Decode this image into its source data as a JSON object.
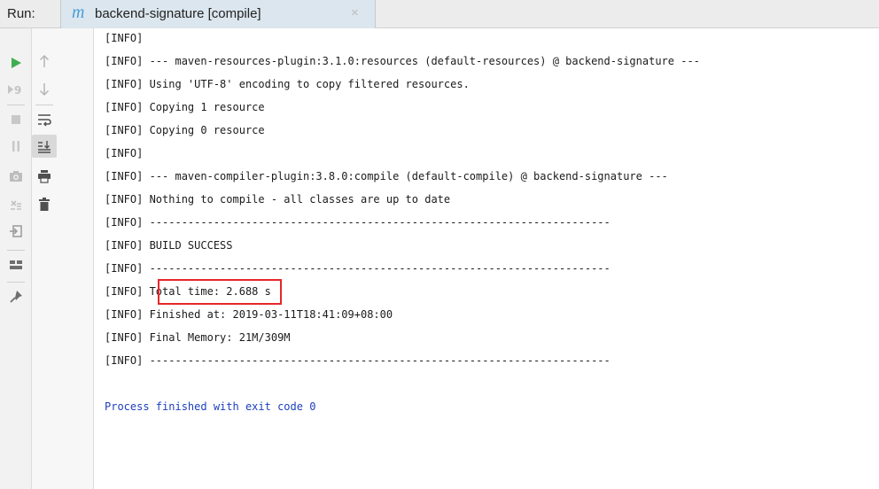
{
  "panel": {
    "run_label": "Run:",
    "tab": {
      "icon": "maven-m-icon",
      "icon_glyph": "m",
      "label": "backend-signature [compile]",
      "close_glyph": "×"
    }
  },
  "toolbar_left": [
    {
      "name": "run-icon"
    },
    {
      "name": "rerun-failed-icon"
    },
    {
      "name": "stop-icon"
    },
    {
      "name": "pause-icon"
    },
    {
      "name": "screenshot-icon"
    },
    {
      "name": "exclude-icon"
    },
    {
      "name": "import-icon"
    },
    {
      "name": "layout-icon"
    },
    {
      "name": "pin-icon"
    }
  ],
  "toolbar_right": [
    {
      "name": "up-arrow-icon"
    },
    {
      "name": "down-arrow-icon"
    },
    {
      "name": "soft-wrap-icon"
    },
    {
      "name": "scroll-to-end-icon"
    },
    {
      "name": "print-icon"
    },
    {
      "name": "trash-icon"
    }
  ],
  "console": {
    "lines": [
      "[INFO]",
      "[INFO] --- maven-resources-plugin:3.1.0:resources (default-resources) @ backend-signature ---",
      "[INFO] Using 'UTF-8' encoding to copy filtered resources.",
      "[INFO] Copying 1 resource",
      "[INFO] Copying 0 resource",
      "[INFO]",
      "[INFO] --- maven-compiler-plugin:3.8.0:compile (default-compile) @ backend-signature ---",
      "[INFO] Nothing to compile - all classes are up to date",
      "[INFO] ------------------------------------------------------------------------",
      "[INFO] BUILD SUCCESS",
      "[INFO] ------------------------------------------------------------------------",
      "[INFO] Total time: 2.688 s",
      "[INFO] Finished at: 2019-03-11T18:41:09+08:00",
      "[INFO] Final Memory: 21M/309M",
      "[INFO] ------------------------------------------------------------------------"
    ],
    "process_line": "Process finished with exit code 0"
  },
  "colors": {
    "highlight_border": "#e8262a",
    "process_text": "#1d3fbd",
    "run_icon": "#3fae4f"
  }
}
